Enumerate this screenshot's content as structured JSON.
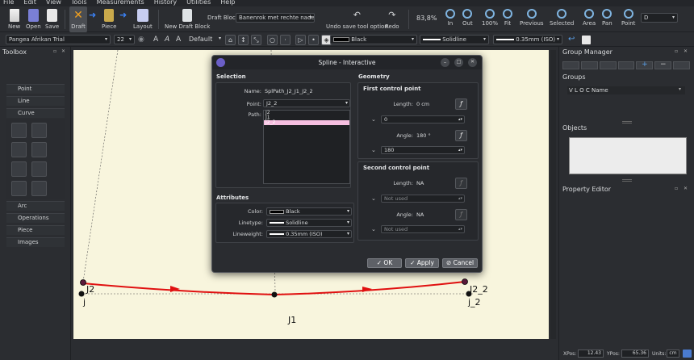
{
  "menubar": [
    "File",
    "Edit",
    "View",
    "Tools",
    "Measurements",
    "History",
    "Utilities",
    "Help"
  ],
  "toolbar": {
    "new": "New",
    "open": "Open",
    "save": "Save",
    "draft": "Draft",
    "piece": "Piece",
    "layout": "Layout",
    "new_draft_block": "New Draft Block",
    "draft_block_label": "Draft Block:",
    "draft_block_value": "Banenrok met rechte naden",
    "undo": "Undo save tool option",
    "redo": "Redo",
    "zoom": "83,8%",
    "zoom_in": "In",
    "zoom_out": "Out",
    "zoom_100": "100%",
    "fit": "Fit",
    "previous": "Previous",
    "selected": "Selected",
    "area": "Area",
    "pan": "Pan",
    "point": "Point",
    "layer": "D"
  },
  "toolbar2": {
    "font": "Pangea Afrikan Trial",
    "font_size": "22",
    "default_label": "Default",
    "color": "Black",
    "linetype": "Solidline",
    "lineweight": "0.35mm (ISO)"
  },
  "toolbox": {
    "title": "Toolbox",
    "sections": [
      "Point",
      "Line",
      "Curve",
      "Arc",
      "Operations",
      "Piece",
      "Images"
    ]
  },
  "canvas": {
    "labels": [
      "J2",
      "j",
      "J2_2",
      "j_2",
      "J1"
    ]
  },
  "right_panel": {
    "group_manager": "Group Manager",
    "groups": "Groups",
    "columns": "V L O C Name",
    "objects": "Objects",
    "property_editor": "Property Editor"
  },
  "status": {
    "xpos_label": "XPos:",
    "xpos": "12.43",
    "ypos_label": "YPos:",
    "ypos": "65.36",
    "units_label": "Units:",
    "units": "cm"
  },
  "dialog": {
    "title": "Spline - Interactive",
    "selection": "Selection",
    "name_label": "Name:",
    "name_value": "SplPath_J2_J1_J2_2",
    "point_label": "Point:",
    "point_value": "J2_2",
    "path_label": "Path:",
    "path_items": [
      "J2",
      "J1",
      "J2_2"
    ],
    "attributes": "Attributes",
    "color_label": "Color:",
    "color_value": "Black",
    "linetype_label": "Linetype:",
    "linetype_value": "Solidline",
    "lineweight_label": "Lineweight:",
    "lineweight_value": "0.35mm (ISO)",
    "geometry": "Geometry",
    "first_cp": "First control point",
    "length_label": "Length:",
    "first_length": "0 cm",
    "first_length_formula": "0",
    "angle_label": "Angle:",
    "first_angle": "180 °",
    "first_angle_formula": "180",
    "second_cp": "Second control point",
    "second_length": "NA",
    "second_length_formula": "Not used",
    "second_angle": "NA",
    "second_angle_formula": "Not used",
    "ok": "OK",
    "apply": "Apply",
    "cancel": "Cancel"
  }
}
